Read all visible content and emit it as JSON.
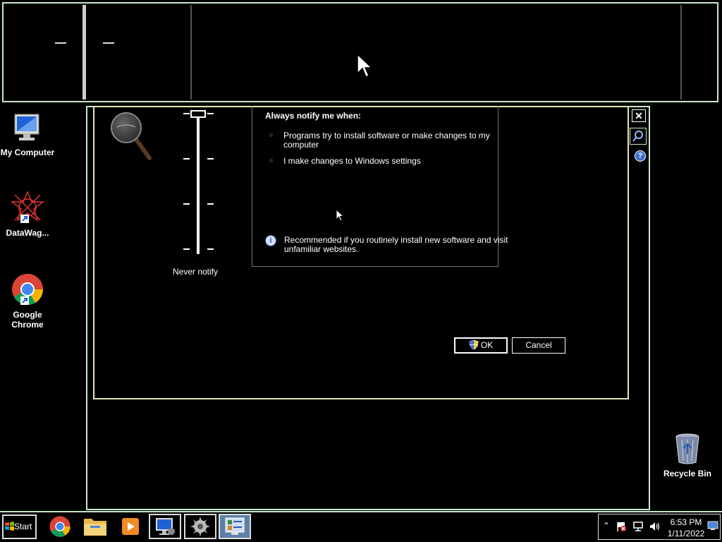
{
  "dialog": {
    "info_title": "Always notify me when:",
    "item_1_line_1": "Programs try to install software or make changes to my",
    "item_1_line_2": "computer",
    "item_2": "I make changes to Windows settings",
    "recommend_line_1": "Recommended if you routinely install new software and visit",
    "recommend_line_2": "unfamiliar websites.",
    "slider_bottom_label": "Never notify",
    "slider_level": 1.0,
    "ok_label": "OK",
    "cancel_label": "Cancel"
  },
  "background_window": {
    "close_glyph": "✕",
    "help_glyph": "?"
  },
  "desktop_icons": [
    {
      "label": "My Computer",
      "icon": "my-computer-icon"
    },
    {
      "label": "DataWag...",
      "icon": "datawag-icon"
    },
    {
      "label": "Google Chrome",
      "icon": "chrome-icon"
    },
    {
      "label": "Recycle Bin",
      "icon": "recycle-bin-icon"
    }
  ],
  "taskbar": {
    "start_label": "Start",
    "pinned": [
      "chrome-icon",
      "file-explorer-icon",
      "media-player-icon",
      "remote-desktop-icon",
      "gear-app-icon",
      "control-panel-icon"
    ],
    "tray_icons": [
      "show-hidden-icons-chevron",
      "action-center-flag-icon",
      "network-icon",
      "volume-icon",
      "show-desktop-icon"
    ],
    "clock_time": "6:53 PM",
    "clock_date": "1/11/2022"
  },
  "colors": {
    "frame_green": "#c8e6c8",
    "dialog_frame": "#e2e6b8",
    "info_blue": "#2a5ab8"
  }
}
